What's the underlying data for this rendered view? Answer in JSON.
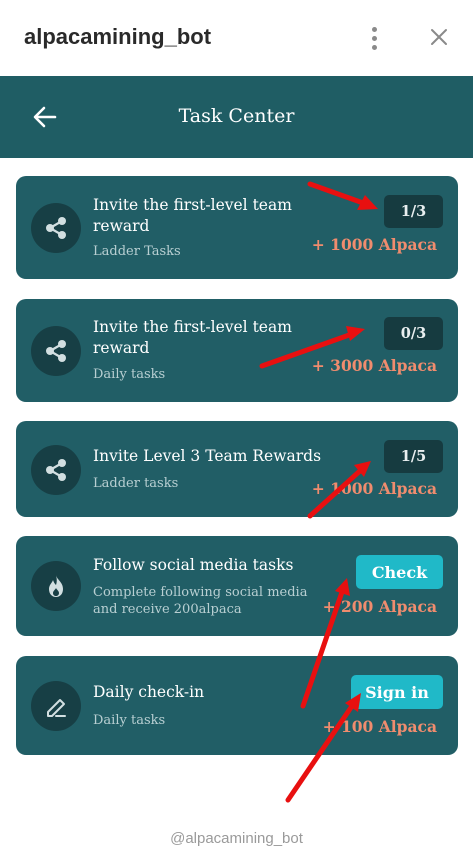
{
  "app": {
    "bot_name": "alpacamining_bot",
    "footer_handle": "@alpacamining_bot"
  },
  "header": {
    "title": "Task Center"
  },
  "tasks": [
    {
      "title": "Invite the first-level team reward",
      "subtitle": "Ladder Tasks",
      "progress": "1/3",
      "reward": "+ 1000 Alpaca",
      "icon": "share-icon"
    },
    {
      "title": "Invite the first-level team reward",
      "subtitle": "Daily tasks",
      "progress": "0/3",
      "reward": "+ 3000 Alpaca",
      "icon": "share-icon"
    },
    {
      "title": "Invite Level 3 Team Rewards",
      "subtitle": "Ladder tasks",
      "progress": "1/5",
      "reward": "+ 1000 Alpaca",
      "icon": "share-icon"
    },
    {
      "title": "Follow social media tasks",
      "subtitle": "Complete following social media and receive 200alpaca",
      "action": "Check",
      "reward": "+ 200 Alpaca",
      "icon": "flame-icon"
    },
    {
      "title": "Daily check-in",
      "subtitle": "Daily tasks",
      "action": "Sign in",
      "reward": "+ 100 Alpaca",
      "icon": "pen-icon"
    }
  ],
  "colors": {
    "header_bg": "#1f5d64",
    "card_bg": "#215e66",
    "icon_bg": "#173f45",
    "counter_bg": "#163b40",
    "action_bg": "#20b9c8",
    "reward_text": "#f08c6e",
    "annotation_arrow": "#e81010"
  }
}
